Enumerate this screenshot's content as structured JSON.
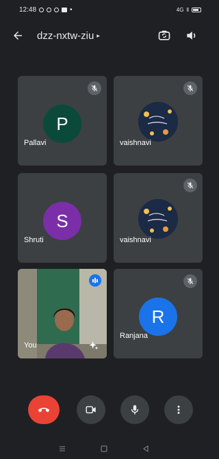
{
  "status_bar": {
    "time": "12:48",
    "network": "4G",
    "signal": "ll"
  },
  "header": {
    "meeting_code": "dzz-nxtw-ziu",
    "chevron": "▸"
  },
  "participants": [
    {
      "name": "Pallavi",
      "avatar_letter": "P",
      "avatar_color": "#0b4a3a",
      "muted": true,
      "type": "letter"
    },
    {
      "name": "vaishnavi",
      "avatar_image": "lamps-image",
      "muted": true,
      "type": "image"
    },
    {
      "name": "Shruti",
      "avatar_letter": "S",
      "avatar_color": "#7b2ea8",
      "muted": false,
      "type": "letter"
    },
    {
      "name": "vaishnavi",
      "avatar_image": "lamps-image",
      "muted": true,
      "type": "image"
    },
    {
      "name": "You",
      "type": "self-video",
      "speaking": true
    },
    {
      "name": "Ranjana",
      "avatar_letter": "R",
      "avatar_color": "#1a73e8",
      "muted": true,
      "type": "letter"
    }
  ],
  "colors": {
    "background": "#1f2023",
    "tile": "#3c4043",
    "end_call": "#ea4335",
    "accent": "#1a73e8"
  },
  "icons": {
    "back": "arrow-left-icon",
    "switch_camera": "switch-camera-icon",
    "speaker": "speaker-icon",
    "mic_off": "mic-off-icon",
    "end_call": "phone-hangup-icon",
    "camera": "video-camera-icon",
    "mic": "microphone-icon",
    "more": "more-vert-icon",
    "effects": "sparkle-icon"
  }
}
